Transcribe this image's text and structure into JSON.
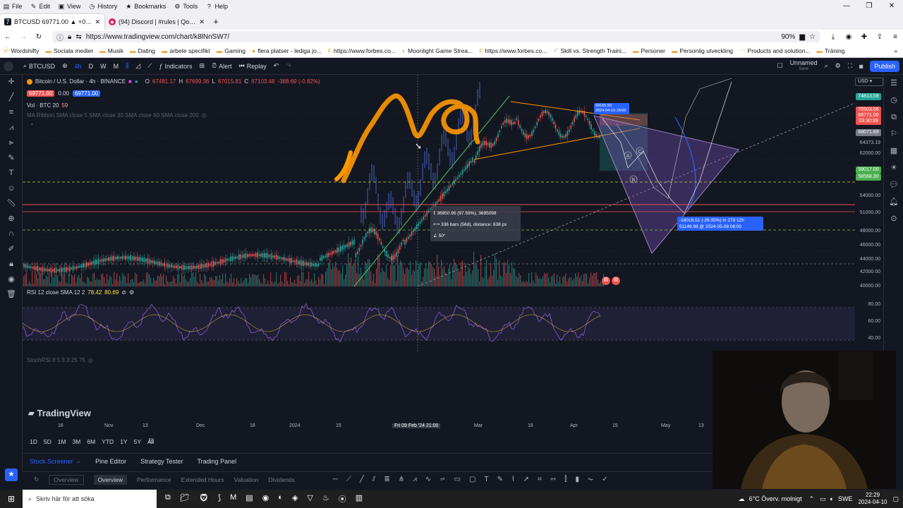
{
  "browser": {
    "menu": [
      {
        "icon": "file-icon",
        "label": "File"
      },
      {
        "icon": "edit-icon",
        "label": "Edit"
      },
      {
        "icon": "view-icon",
        "label": "View"
      },
      {
        "icon": "history-icon",
        "label": "History"
      },
      {
        "icon": "star-icon",
        "label": "Bookmarks"
      },
      {
        "icon": "tools-icon",
        "label": "Tools"
      },
      {
        "icon": "help-icon",
        "label": "Help"
      }
    ],
    "tabs": [
      {
        "label": "BTCUSD 69771.00 ▲ +0.8% Unn",
        "active": true
      },
      {
        "label": "(94) Discord | #rules | Qortal Pr",
        "active": false
      }
    ],
    "url": "https://www.tradingview.com/chart/k8lNnSW7/",
    "zoom": "90%",
    "bookmarks": [
      "Wordshifty",
      "Sociala medier",
      "Musik",
      "Dating",
      "arbete specifikt",
      "Gaming",
      "flera platser - lediga jo...",
      "https://www.forbes.co...",
      "Moonlight Game Strea...",
      "https://www.forbes.co...",
      "Skill vs. Strength Traini...",
      "Personer",
      "Personlig utveckling",
      "Products and solution...",
      "Träning"
    ]
  },
  "tv": {
    "symbol": "BTCUSD",
    "intervals": [
      "4h",
      "D",
      "W",
      "M"
    ],
    "indicators_label": "Indicators",
    "alert_label": "Alert",
    "replay_label": "Replay",
    "layout_name": "Unnamed",
    "layout_sub": "Save",
    "publish_label": "Publish",
    "currency": "USD",
    "legend": {
      "title": "Bitcoin / U.S. Dollar · 4h · BINANCE",
      "o": "O",
      "o_val": "67481.17",
      "h": "H",
      "h_val": "67699.36",
      "l": "L",
      "l_val": "67015.81",
      "c": "C",
      "c_val": "67103.48",
      "chg": "-388.69 (-0.82%)",
      "bid": "69771.00",
      "spread": "0.00",
      "ask": "69771.00",
      "vol": "Vol · BTC  20",
      "vol_val": "59",
      "ma": "MA Ribbon SMA close 5 SMA close 30 SMA close 60 SMA close 200"
    },
    "rsi_legend": "RSI 12 close SMA 12 2",
    "rsi_val1": "78.42",
    "rsi_val2": "80.69",
    "stoch_legend": "StochRSI 8 5 3 3 25 75",
    "price_labels": [
      "74813.58",
      "70503.06",
      "69771.00",
      "03:30:39",
      "68071.69",
      "64373.19",
      "62000.00",
      "59017.00",
      "58568.30",
      "54000.00",
      "51000.00",
      "48000.00",
      "46000.00",
      "44000.00",
      "42000.00",
      "40000.00"
    ],
    "rsi_labels": [
      "80.00",
      "60.00",
      "40.00"
    ],
    "time_labels": [
      "16",
      "Nov",
      "13",
      "Dec",
      "18",
      "2024",
      "15",
      "Fri 09 Feb '24  21:00",
      "Mar",
      "18",
      "Apr",
      "15",
      "May",
      "13"
    ],
    "measure": {
      "l1": "36950.95 (97.59%), 3695098",
      "l2": "336 bars (56d), distance: 638 px",
      "l3": "50°"
    },
    "pred": {
      "l1": "-18018.51 (-26.05%) in 27d 12h",
      "l2": "51146.98 @ 2024-05-08  06:00"
    },
    "pin": {
      "l1": "69165.50",
      "l2": "2024-04-10  18:00"
    },
    "wave_labels": [
      "A",
      "B",
      "C"
    ],
    "logo": "TradingView",
    "periods": [
      "1D",
      "5D",
      "1M",
      "3M",
      "6M",
      "YTD",
      "1Y",
      "5Y",
      "All"
    ],
    "bottom_tabs": [
      "Stock Screener",
      "Pine Editor",
      "Strategy Tester",
      "Trading Panel"
    ],
    "screener_tabs": [
      "Overview",
      "Overview",
      "Performance",
      "Extended Hours",
      "Valuation",
      "Dividends"
    ]
  },
  "taskbar": {
    "search": "Skriv här för att söka",
    "weather": "6°C  Överv. molnigt",
    "lang": "SWE",
    "time": "22:29",
    "date": "2024-04-10"
  },
  "colors": {
    "accent": "#2962ff",
    "green": "#26a69a",
    "red": "#ef5350",
    "orange": "#ff9800",
    "purple": "#7e57c2"
  }
}
